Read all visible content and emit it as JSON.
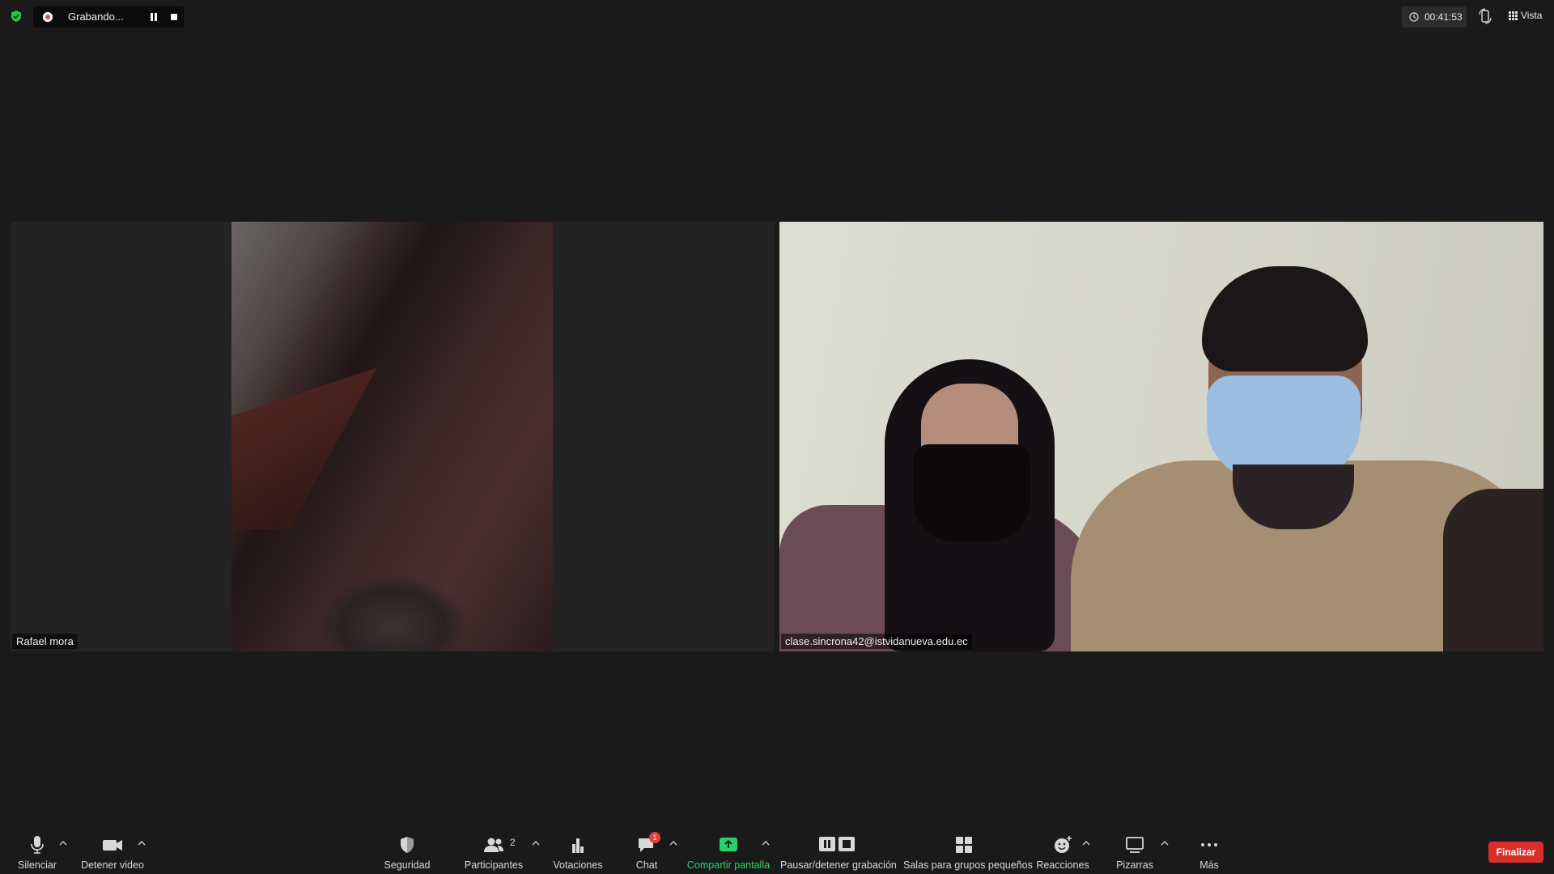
{
  "recording": {
    "label": "Grabando..."
  },
  "header": {
    "timer": "00:41:53",
    "view_label": "Vista"
  },
  "participants": [
    {
      "name": "Rafael mora"
    },
    {
      "name": "clase.sincrona42@istvidanueva.edu.ec"
    }
  ],
  "toolbar": {
    "mute_label": "Silenciar",
    "video_label": "Detener video",
    "security_label": "Seguridad",
    "participants_label": "Participantes",
    "participants_count": "2",
    "polls_label": "Votaciones",
    "chat_label": "Chat",
    "chat_badge": "1",
    "share_label": "Compartir pantalla",
    "record_label": "Pausar/detener grabación",
    "breakout_label": "Salas para grupos pequeños",
    "reactions_label": "Reacciones",
    "whiteboards_label": "Pizarras",
    "more_label": "Más",
    "end_label": "Finalizar"
  },
  "colors": {
    "share_green": "#27d36a",
    "end_red": "#d92f2b",
    "shield_green": "#23c552"
  }
}
